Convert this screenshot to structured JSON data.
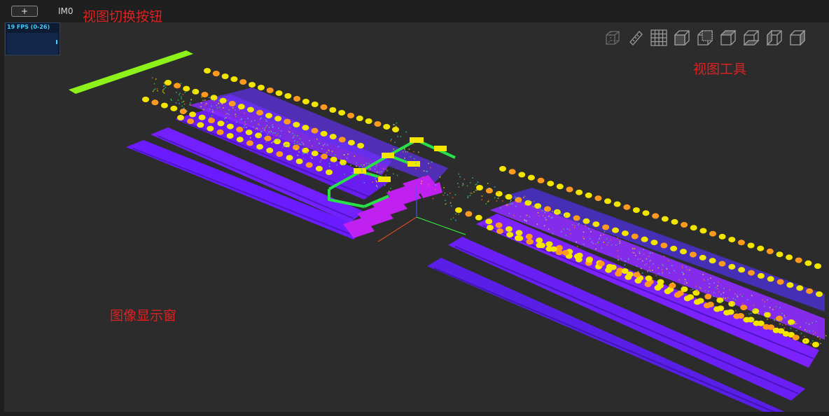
{
  "topbar": {
    "add_button_label": "+",
    "view_name": "IM0"
  },
  "fps": {
    "text": "19 FPS (0-26)"
  },
  "annotations": {
    "view_switch": "视图切换按钮",
    "view_tools": "视图工具",
    "image_window": "图像显示窗"
  },
  "toolbar": {
    "icons": [
      "wireframe-cube-icon",
      "ruler-icon",
      "grid-icon",
      "cube-front-icon",
      "cube-back-icon",
      "cube-top-icon",
      "cube-bottom-icon",
      "cube-left-icon",
      "cube-right-icon"
    ]
  },
  "colors": {
    "annotation": "#e02020",
    "fps": "#3ad0ff",
    "ground_violet": "#6a1bff",
    "ground_magenta": "#c020f0",
    "lamp_yellow": "#f2e600",
    "lamp_orange": "#ff9a1e",
    "pipe_green": "#28e04a",
    "strip_lime": "#8cf21a"
  }
}
